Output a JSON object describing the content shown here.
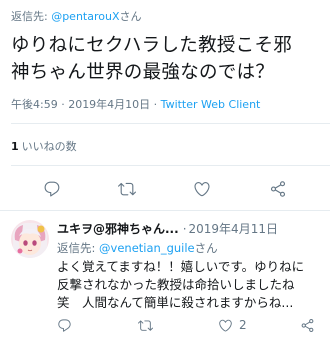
{
  "tweet": {
    "reply_to_prefix": "返信先: ",
    "reply_to_handle": "@pentarouX",
    "reply_to_suffix": "さん",
    "text_line1": "ゆりねにセクハラした教授こそ邪",
    "text_line2": "神ちゃん世界の最強なのでは？",
    "time": "午後4:59 · 2019年4月10日 · ",
    "client": "Twitter Web Client",
    "likes_count": "1",
    "likes_label": "いいねの数"
  },
  "reply": {
    "name": "ユキヲ@邪神ちゃん...",
    "separator": "·",
    "date": "2019年4月11日",
    "reply_to_prefix": "返信先: ",
    "reply_to_handle": "@venetian_guile",
    "reply_to_suffix": "さん",
    "text_line1": "よく覚えてますね！！嬉しいです。ゆりねに",
    "text_line2": "反撃されなかった教授は命拾いしましたね",
    "text_line3": "笑　人間なんて簡単に殺されますからね...",
    "like_count": "2"
  },
  "icons": {
    "reply": "reply-icon",
    "retweet": "retweet-icon",
    "like": "heart-icon",
    "share": "share-icon"
  },
  "colors": {
    "link": "#1da1f2",
    "secondary": "#657786",
    "text": "#14171a",
    "divider": "#e6ecf0"
  }
}
